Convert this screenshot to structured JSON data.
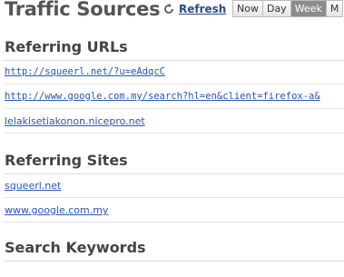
{
  "header": {
    "title": "Traffic Sources",
    "refresh_label": "Refresh",
    "range_tabs": [
      {
        "label": "Now",
        "active": false
      },
      {
        "label": "Day",
        "active": false
      },
      {
        "label": "Week",
        "active": true
      },
      {
        "label": "M",
        "active": false
      }
    ]
  },
  "referring_urls": {
    "heading": "Referring URLs",
    "items": [
      "http://squeerl.net/?u=eAdqcC",
      "http://www.google.com.my/search?hl=en&client=firefox-a&",
      "lelakisetiakonon.nicepro.net"
    ]
  },
  "referring_sites": {
    "heading": "Referring Sites",
    "items": [
      "squeerl.net",
      "www.google.com.my"
    ]
  },
  "search_keywords": {
    "heading": "Search Keywords"
  },
  "colors": {
    "link": "#2a56b5",
    "active_tab": "#8c8c8c",
    "title": "#555555"
  }
}
